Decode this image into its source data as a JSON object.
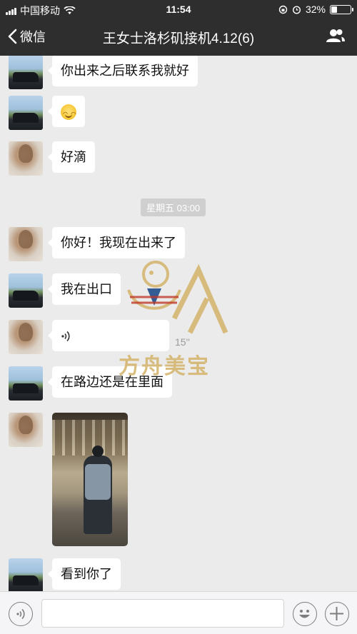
{
  "status_bar": {
    "carrier": "中国移动",
    "time": "11:54",
    "battery_text": "32%",
    "battery_level": 0.32
  },
  "nav": {
    "back_label": "微信",
    "title": "王女士洛杉矶接机4.12(6)",
    "back_icon": "chevron-left-icon",
    "people_icon": "group-members-icon"
  },
  "messages": [
    {
      "sender": "car",
      "type": "text",
      "text": "你出来之后联系我就好"
    },
    {
      "sender": "car",
      "type": "emoji",
      "emoji": "smiley-emoji"
    },
    {
      "sender": "girl",
      "type": "text",
      "text": "好滴"
    },
    {
      "sender": "girl",
      "type": "text",
      "text": "你好！我现在出来了"
    },
    {
      "sender": "car",
      "type": "text",
      "text": "我在出口"
    },
    {
      "sender": "girl",
      "type": "voice",
      "duration": "15''"
    },
    {
      "sender": "car",
      "type": "text",
      "text": "在路边还是在里面"
    },
    {
      "sender": "girl",
      "type": "image",
      "image": "airport-photo"
    },
    {
      "sender": "car",
      "type": "text",
      "text": "看到你了"
    }
  ],
  "timestamp": "星期五 03:00",
  "watermark": {
    "text": "方舟美宝",
    "color": "#d4b36a"
  },
  "input_bar": {
    "value": ""
  },
  "colors": {
    "header_bg": "#2e2e2e",
    "chat_bg": "#ebebeb",
    "bubble_bg": "#ffffff"
  }
}
